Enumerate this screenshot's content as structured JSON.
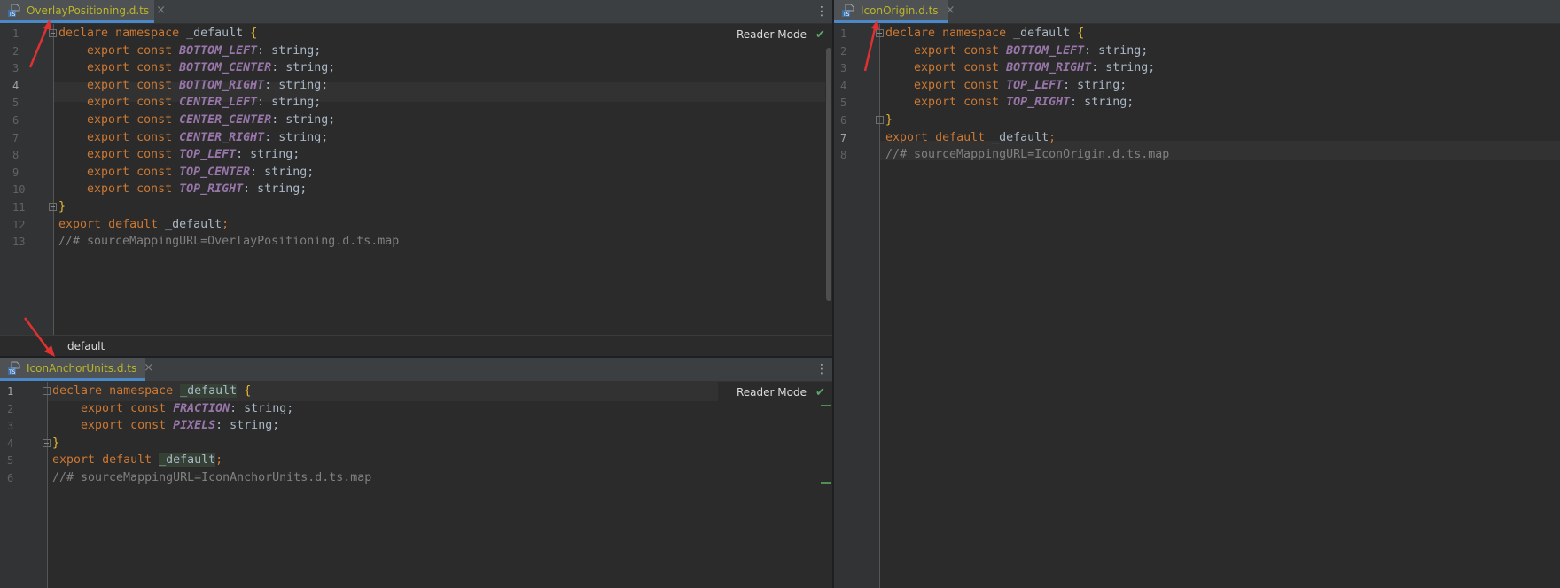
{
  "colors": {
    "keyword": "#cc7832",
    "identifier": "#a9b7c6",
    "constant": "#9876aa",
    "comment": "#808080",
    "tab_name": "#bbb529",
    "annotation_arrow": "#e03131"
  },
  "left_top": {
    "tab": {
      "name": "OverlayPositioning.d.ts",
      "close": "×",
      "icon": "typescript-file-icon"
    },
    "menu": "⋮",
    "reader_mode": "Reader Mode",
    "check": "✔",
    "breadcrumb": "_default",
    "line_numbers": [
      "1",
      "2",
      "3",
      "4",
      "5",
      "6",
      "7",
      "8",
      "9",
      "10",
      "11",
      "12",
      "13"
    ],
    "lines": [
      {
        "kw1": "declare",
        "kw2": "namespace",
        "id": "_default",
        "rest": "{"
      },
      {
        "kw1": "export",
        "kw2": "const",
        "const": "BOTTOM_LEFT",
        "rest": ": string;"
      },
      {
        "kw1": "export",
        "kw2": "const",
        "const": "BOTTOM_CENTER",
        "rest": ": string;"
      },
      {
        "kw1": "export",
        "kw2": "const",
        "const": "BOTTOM_RIGHT",
        "rest": ": string;"
      },
      {
        "kw1": "export",
        "kw2": "const",
        "const": "CENTER_LEFT",
        "rest": ": string;"
      },
      {
        "kw1": "export",
        "kw2": "const",
        "const": "CENTER_CENTER",
        "rest": ": string;"
      },
      {
        "kw1": "export",
        "kw2": "const",
        "const": "CENTER_RIGHT",
        "rest": ": string;"
      },
      {
        "kw1": "export",
        "kw2": "const",
        "const": "TOP_LEFT",
        "rest": ": string;"
      },
      {
        "kw1": "export",
        "kw2": "const",
        "const": "TOP_CENTER",
        "rest": ": string;"
      },
      {
        "kw1": "export",
        "kw2": "const",
        "const": "TOP_RIGHT",
        "rest": ": string;"
      },
      {
        "brace": "}"
      },
      {
        "kw1": "export",
        "kw2": "default",
        "id": "_default",
        "rest": ";"
      },
      {
        "comment": "//# sourceMappingURL=OverlayPositioning.d.ts.map"
      }
    ]
  },
  "left_bottom": {
    "tab": {
      "name": "IconAnchorUnits.d.ts",
      "close": "×",
      "icon": "typescript-file-icon"
    },
    "menu": "⋮",
    "reader_mode": "Reader Mode",
    "check": "✔",
    "line_numbers": [
      "1",
      "2",
      "3",
      "4",
      "5",
      "6"
    ],
    "lines": [
      {
        "kw1": "declare",
        "kw2": "namespace",
        "id": "_default",
        "rest": "{"
      },
      {
        "kw1": "export",
        "kw2": "const",
        "const": "FRACTION",
        "rest": ": string;"
      },
      {
        "kw1": "export",
        "kw2": "const",
        "const": "PIXELS",
        "rest": ": string;"
      },
      {
        "brace": "}"
      },
      {
        "kw1": "export",
        "kw2": "default",
        "id": "_default",
        "rest": ";"
      },
      {
        "comment": "//# sourceMappingURL=IconAnchorUnits.d.ts.map"
      }
    ]
  },
  "right": {
    "tab": {
      "name": "IconOrigin.d.ts",
      "close": "×",
      "icon": "typescript-file-icon"
    },
    "line_numbers": [
      "1",
      "2",
      "3",
      "4",
      "5",
      "6",
      "7",
      "8"
    ],
    "lines": [
      {
        "kw1": "declare",
        "kw2": "namespace",
        "id": "_default",
        "rest": "{"
      },
      {
        "kw1": "export",
        "kw2": "const",
        "const": "BOTTOM_LEFT",
        "rest": ": string;"
      },
      {
        "kw1": "export",
        "kw2": "const",
        "const": "BOTTOM_RIGHT",
        "rest": ": string;"
      },
      {
        "kw1": "export",
        "kw2": "const",
        "const": "TOP_LEFT",
        "rest": ": string;"
      },
      {
        "kw1": "export",
        "kw2": "const",
        "const": "TOP_RIGHT",
        "rest": ": string;"
      },
      {
        "brace": "}"
      },
      {
        "kw1": "export",
        "kw2": "default",
        "id": "_default",
        "rest": ";"
      },
      {
        "comment": "//# sourceMappingURL=IconOrigin.d.ts.map"
      }
    ]
  }
}
